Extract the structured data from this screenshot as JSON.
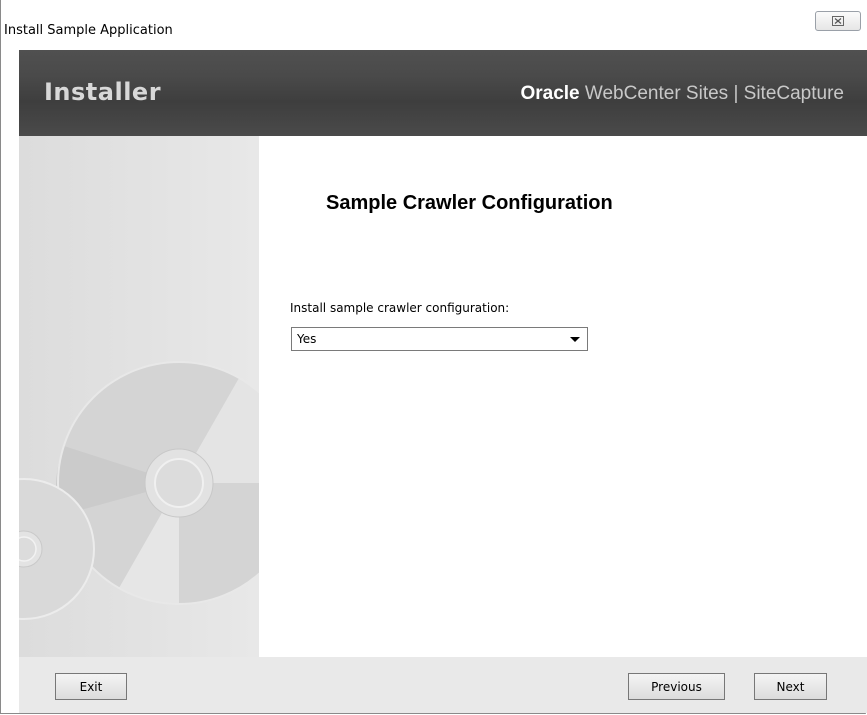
{
  "window": {
    "title": "Install Sample Application",
    "close_glyph": "⊠"
  },
  "header": {
    "brand": "Installer",
    "product_vendor": "Oracle",
    "product_name": "WebCenter Sites | SiteCapture"
  },
  "content": {
    "title": "Sample Crawler Configuration",
    "field_label": "Install sample crawler configuration:",
    "select_value": "Yes",
    "select_icon": "dropdown-arrow-icon"
  },
  "footer": {
    "exit_label": "Exit",
    "previous_label": "Previous",
    "next_label": "Next"
  },
  "colors": {
    "header_background": "#444444",
    "panel_background": "#e0e0e0",
    "footer_background": "#e9e9e9"
  }
}
